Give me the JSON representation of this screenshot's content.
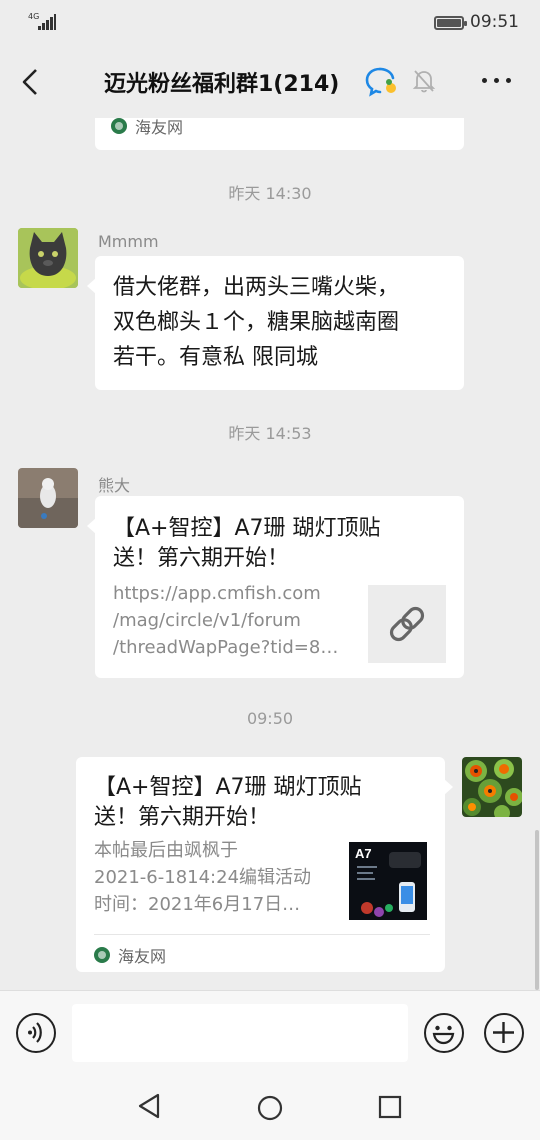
{
  "status_bar": {
    "network": "4G",
    "time": "09:51"
  },
  "header": {
    "title": "迈光粉丝福利群1(214)"
  },
  "messages": {
    "prev_source": "海友网",
    "ts1": "昨天 14:30",
    "m1": {
      "sender": "Mmmm",
      "lines": [
        "借大佬群，出两头三嘴火柴，",
        "双色榔头１个，糖果脑越南圈",
        "若干。有意私 限同城"
      ]
    },
    "ts2": "昨天 14:53",
    "m2": {
      "sender": "熊大",
      "title_lines": [
        "【A+智控】A7珊 瑚灯顶贴",
        "送！第六期开始！"
      ],
      "desc_lines": [
        "https://app.cmfish.com",
        "/mag/circle/v1/forum",
        "/threadWapPage?tid=8…"
      ]
    },
    "ts3": "09:50",
    "m3": {
      "title_lines": [
        "【A+智控】A7珊 瑚灯顶贴",
        "送！第六期开始！"
      ],
      "desc_lines": [
        "本帖最后由飒枫于",
        "2021-6-1814:24编辑活动",
        "时间：2021年6月17日…"
      ],
      "thumb_label": "A7",
      "source": "海友网"
    }
  },
  "colors": {
    "bg": "#ededed",
    "bubble": "#ffffff",
    "source_dot": "#2a7b4a"
  },
  "icons": [
    "back-arrow-icon",
    "group-chat-icon",
    "mute-bell-icon",
    "more-icon",
    "link-icon",
    "voice-icon",
    "emoji-icon",
    "plus-icon",
    "nav-back-icon",
    "nav-home-icon",
    "nav-recents-icon"
  ]
}
